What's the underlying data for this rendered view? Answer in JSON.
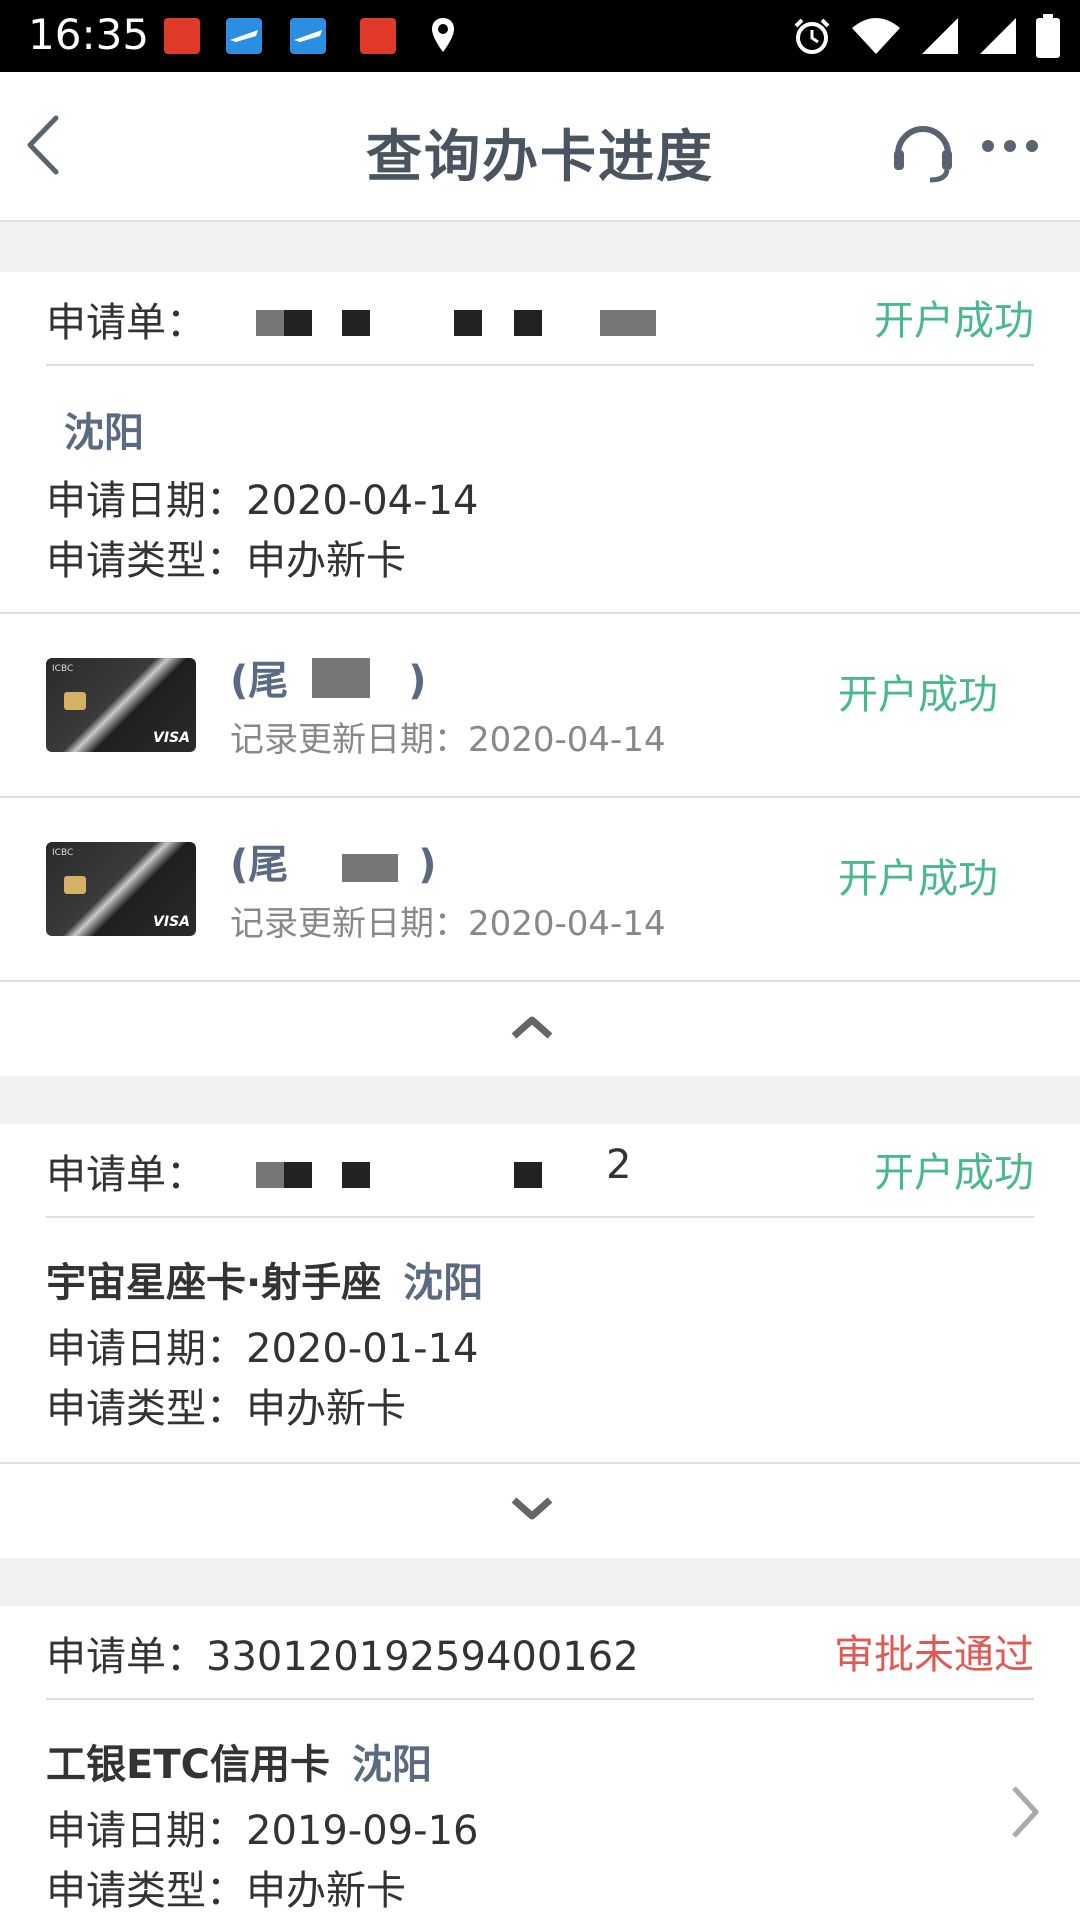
{
  "status_bar": {
    "time": "16:35",
    "icons": [
      "app-icon-red",
      "flight-app-icon",
      "flight-app-icon",
      "app-icon-red",
      "location-icon",
      "alarm-icon",
      "wifi-icon",
      "signal-icon",
      "signal-icon",
      "battery-icon"
    ]
  },
  "nav": {
    "back_icon": "back-icon",
    "title": "查询办卡进度",
    "service_icon": "headset-icon",
    "more_icon": "more-icon"
  },
  "colors": {
    "success": "#49b98c",
    "failure": "#e05a55",
    "city": "#5a6a80",
    "title": "#4a5460"
  },
  "applications": [
    {
      "label": "申请单：",
      "number_suffix": "",
      "status": "开户成功",
      "card_name": "",
      "city": "沈阳",
      "date_label": "申请日期：",
      "date": "2020-04-14",
      "type_label": "申请类型：",
      "type": "申办新卡",
      "cards": [
        {
          "title_prefix": "(尾",
          "title_suffix": ")",
          "update_label": "记录更新日期：",
          "update_date": "2020-04-14",
          "status": "开户成功",
          "card_brand": "VISA"
        },
        {
          "title_prefix": "(尾",
          "title_suffix": ")",
          "update_label": "记录更新日期：",
          "update_date": "2020-04-14",
          "status": "开户成功",
          "card_brand": "VISA"
        }
      ],
      "toggle_icon": "chevron-up-icon"
    },
    {
      "label": "申请单：",
      "number_suffix": "2",
      "status": "开户成功",
      "card_name": "宇宙星座卡·射手座",
      "city": "沈阳",
      "date_label": "申请日期：",
      "date": "2020-01-14",
      "type_label": "申请类型：",
      "type": "申办新卡",
      "toggle_icon": "chevron-down-icon"
    },
    {
      "label": "申请单：",
      "number": "33012019259400162",
      "status": "审批未通过",
      "card_name": "工银ETC信用卡",
      "city": "沈阳",
      "date_label": "申请日期：",
      "date": "2019-09-16",
      "type_label": "申请类型：",
      "type": "申办新卡",
      "detail_icon": "chevron-right-icon"
    }
  ]
}
